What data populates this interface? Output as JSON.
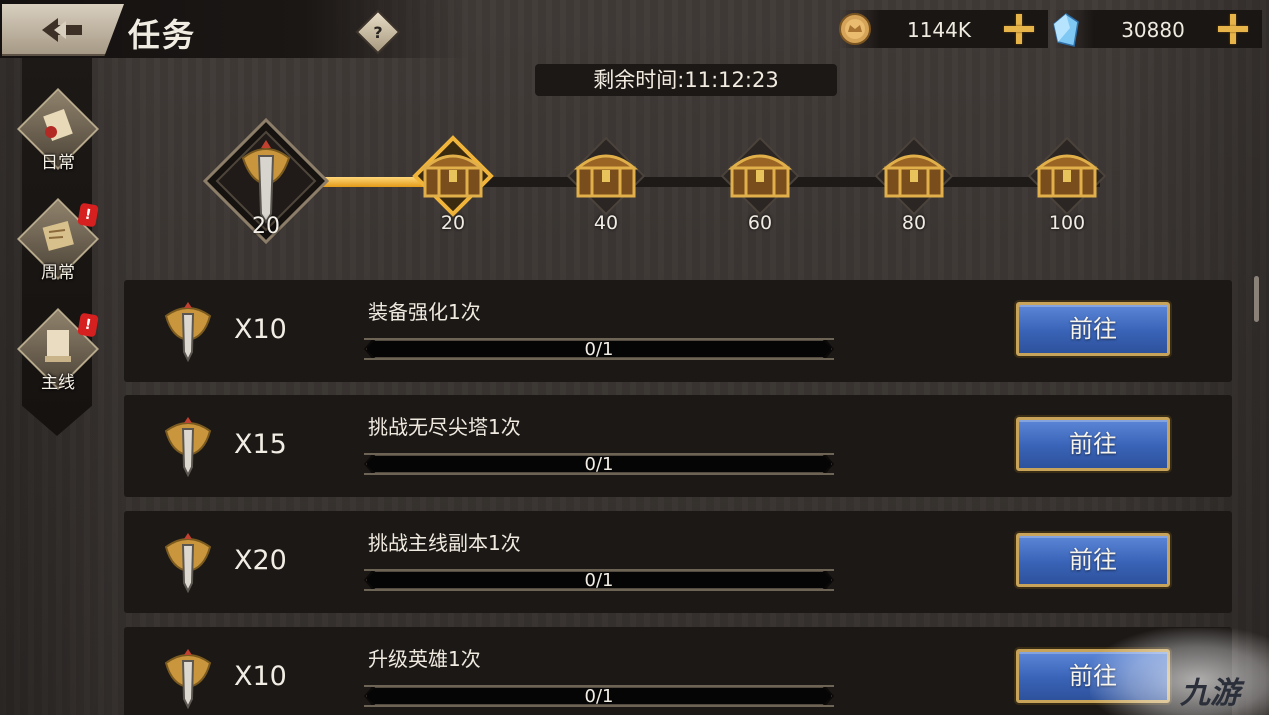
{
  "header": {
    "title": "任务",
    "help_label": "?",
    "currencies": [
      {
        "name": "gold",
        "value": "1144K"
      },
      {
        "name": "gem",
        "value": "30880"
      }
    ]
  },
  "tabs": [
    {
      "label": "日常",
      "alert": false
    },
    {
      "label": "周常",
      "alert": true
    },
    {
      "label": "主线",
      "alert": true
    }
  ],
  "alert_mark": "!",
  "timer": "剩余时间:11:12:23",
  "activity": {
    "current_points": "20",
    "progress_fraction": 0.2,
    "milestones": [
      "20",
      "40",
      "60",
      "80",
      "100"
    ]
  },
  "tasks": [
    {
      "reward": "X10",
      "name": "装备强化1次",
      "progress": "0/1",
      "button": "前往"
    },
    {
      "reward": "X15",
      "name": "挑战无尽尖塔1次",
      "progress": "0/1",
      "button": "前往"
    },
    {
      "reward": "X20",
      "name": "挑战主线副本1次",
      "progress": "0/1",
      "button": "前往"
    },
    {
      "reward": "X10",
      "name": "升级英雄1次",
      "progress": "0/1",
      "button": "前往"
    }
  ],
  "watermark": "九游",
  "colors": {
    "accent_gold": "#e7b44a",
    "button_blue": "#3963b7",
    "alert_red": "#d62020"
  }
}
